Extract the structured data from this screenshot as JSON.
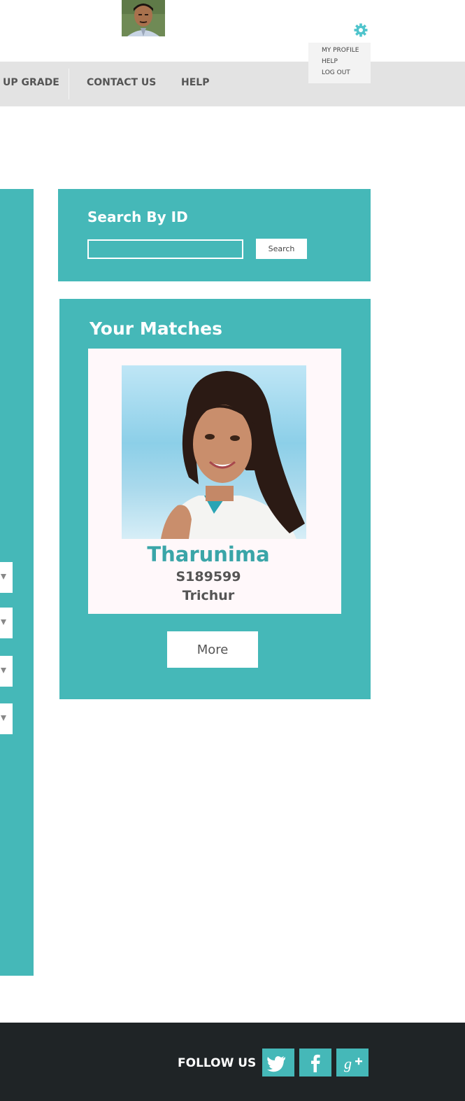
{
  "header": {
    "user_avatar_icon": "user-avatar-photo",
    "settings_icon": "gear-icon"
  },
  "nav": {
    "items": [
      {
        "label": "UP GRADE"
      },
      {
        "label": "CONTACT US"
      },
      {
        "label": "HELP"
      }
    ]
  },
  "user_menu": {
    "items": [
      {
        "label": "MY PROFILE"
      },
      {
        "label": "HELP"
      },
      {
        "label": "LOG OUT"
      }
    ]
  },
  "search": {
    "title": "Search By ID",
    "input_value": "",
    "placeholder": "",
    "button_label": "Search"
  },
  "matches": {
    "title": "Your Matches",
    "card": {
      "photo_icon": "profile-photo",
      "name": "Tharunima",
      "id": "S189599",
      "city": "Trichur"
    },
    "more_label": "More"
  },
  "footer": {
    "follow_label": "FOLLOW US",
    "social": [
      {
        "icon": "twitter-icon"
      },
      {
        "icon": "facebook-icon"
      },
      {
        "icon": "google-plus-icon"
      }
    ]
  },
  "colors": {
    "accent": "#45b8b8",
    "nav_bg": "#e3e3e3",
    "footer_bg": "#1f2426",
    "match_name": "#3aa5a8",
    "card_bg": "#fff8fa"
  }
}
